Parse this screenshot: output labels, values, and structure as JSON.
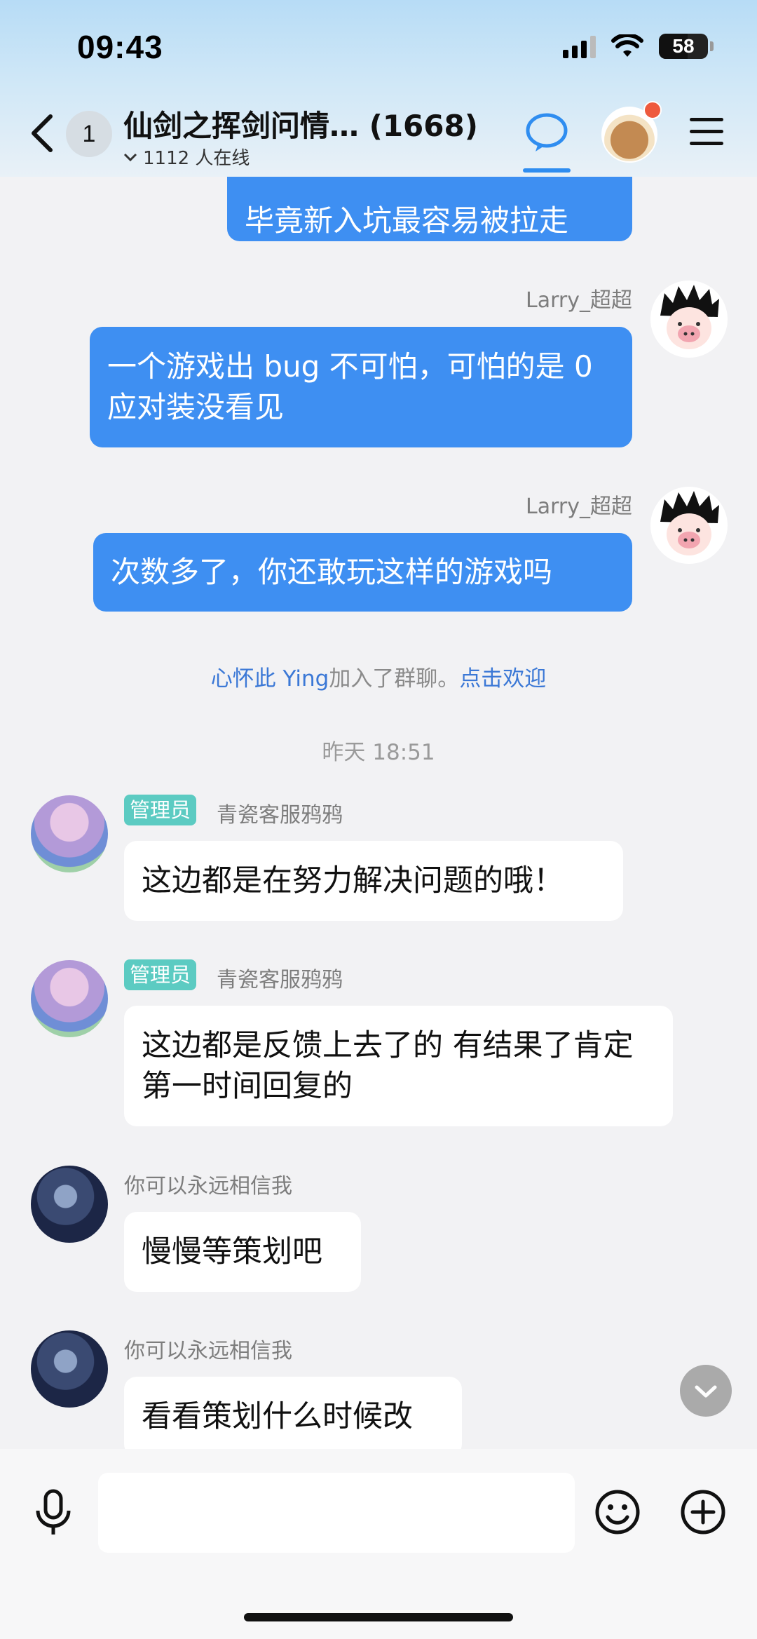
{
  "status_bar": {
    "time": "09:43",
    "battery": "58"
  },
  "header": {
    "back_unread_count": "1",
    "title": "仙剑之挥剑问情… (1668)",
    "online_text": "1112 人在线"
  },
  "messages": [
    {
      "side": "right",
      "text": "毕竟新入坑最容易被拉走"
    },
    {
      "side": "right",
      "sender": "Larry_超超",
      "text": "一个游戏出 bug 不可怕，可怕的是 0应对装没看见"
    },
    {
      "side": "right",
      "sender": "Larry_超超",
      "text": "次数多了，你还敢玩这样的游戏吗"
    },
    {
      "side": "left",
      "badge": "管理员",
      "sender": "青瓷客服鸦鸦",
      "text": "这边都是在努力解决问题的哦！"
    },
    {
      "side": "left",
      "badge": "管理员",
      "sender": "青瓷客服鸦鸦",
      "text": "这边都是反馈上去了的 有结果了肯定第一时间回复的"
    },
    {
      "side": "left",
      "sender": "你可以永远相信我",
      "text": "慢慢等策划吧"
    },
    {
      "side": "left",
      "sender": "你可以永远相信我",
      "text": "看看策划什么时候改"
    }
  ],
  "system": {
    "user": "心怀此 Ying",
    "action": "加入了群聊。",
    "link": "点击欢迎"
  },
  "timestamp": "昨天 18:51",
  "input": {
    "placeholder": ""
  },
  "colors": {
    "my_bubble": "#3e8ff2",
    "admin_badge": "#5ccbc2",
    "link": "#3b78d6"
  }
}
